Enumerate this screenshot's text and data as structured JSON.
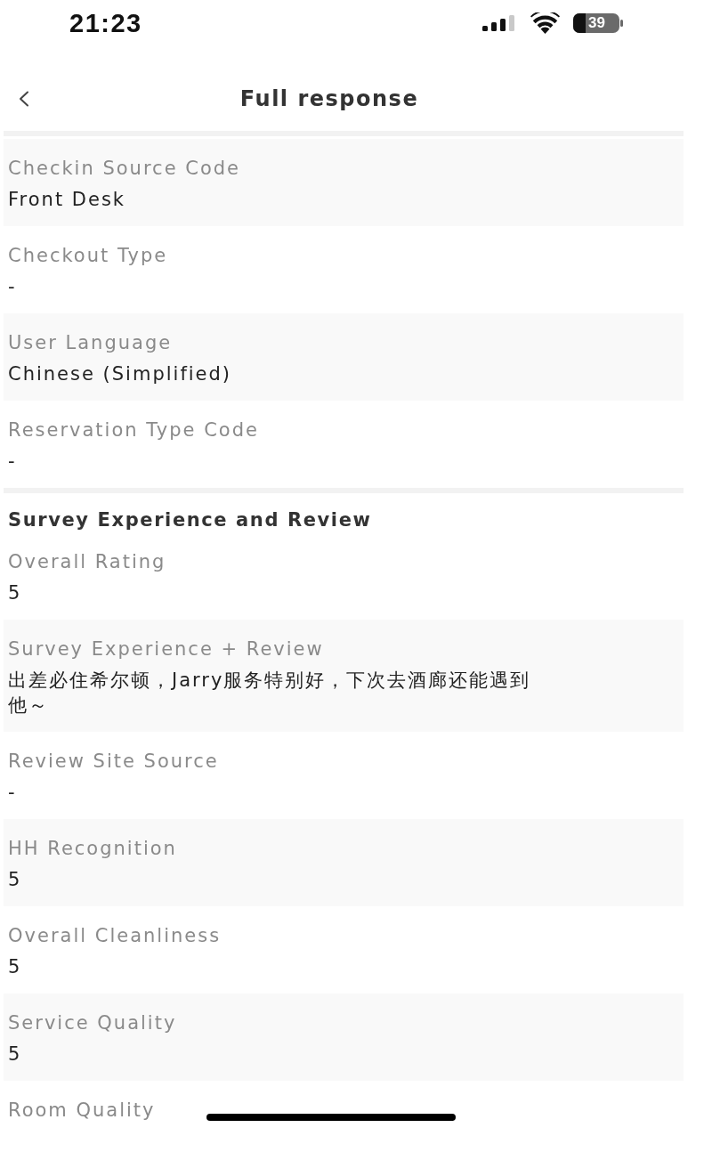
{
  "status_bar": {
    "time": "21:23",
    "battery": "39"
  },
  "header": {
    "title": "Full response"
  },
  "fields": [
    {
      "label": "Checkin Source Code",
      "value": "Front Desk"
    },
    {
      "label": "Checkout Type",
      "value": "-"
    },
    {
      "label": "User Language",
      "value": "Chinese (Simplified)"
    },
    {
      "label": "Reservation Type Code",
      "value": "-"
    }
  ],
  "sections": [
    {
      "title": "Survey Experience and Review",
      "fields": [
        {
          "label": "Overall Rating",
          "value": "5"
        },
        {
          "label": "Survey Experience + Review",
          "value": "出差必住希尔顿，Jarry服务特别好，下次去酒廊还能遇到他～"
        },
        {
          "label": "Review Site Source",
          "value": "-"
        },
        {
          "label": "HH Recognition",
          "value": "5"
        },
        {
          "label": "Overall Cleanliness",
          "value": "5"
        },
        {
          "label": "Service Quality",
          "value": "5"
        },
        {
          "label": "Room Quality"
        }
      ]
    }
  ]
}
